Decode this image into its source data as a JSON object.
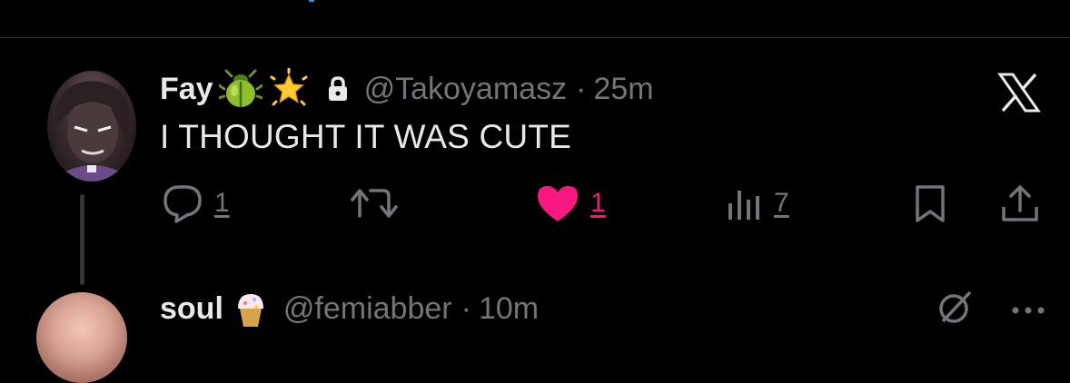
{
  "tweet": {
    "display_name": "Fay",
    "name_emojis": [
      "beetle-emoji",
      "glowing-star-emoji"
    ],
    "protected_icon": "lock-icon",
    "handle": "@Takoyamasz",
    "separator": "·",
    "time": "25m",
    "text": "I THOUGHT IT WAS CUTE",
    "source_icon": "x-logo-icon",
    "actions": {
      "reply": {
        "icon": "reply-icon",
        "count": "1"
      },
      "retweet": {
        "icon": "retweet-icon"
      },
      "like": {
        "icon": "heart-icon",
        "count": "1",
        "liked": true
      },
      "views": {
        "icon": "analytics-icon",
        "count": "7"
      },
      "bookmark": {
        "icon": "bookmark-icon"
      },
      "share": {
        "icon": "share-icon"
      }
    }
  },
  "next_tweet": {
    "display_name": "soul",
    "name_emoji": "cupcake-emoji",
    "handle": "@femiabber",
    "separator": "·",
    "time": "10m"
  },
  "colors": {
    "background": "#000000",
    "text_primary": "#e7e9ea",
    "text_secondary": "#71767b",
    "like_pink": "#f91880",
    "divider": "#2f3336"
  }
}
